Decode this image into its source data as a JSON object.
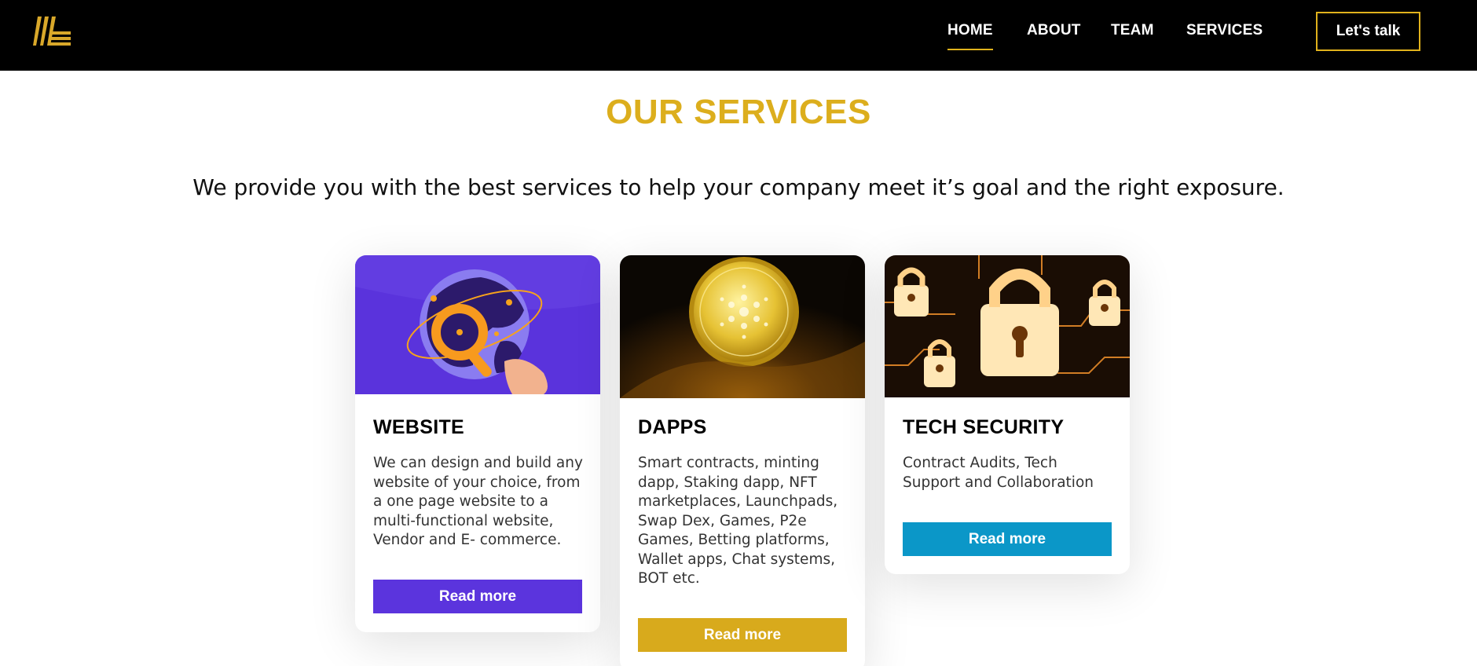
{
  "nav": {
    "items": [
      {
        "label": "HOME",
        "active": true
      },
      {
        "label": "ABOUT",
        "active": false
      },
      {
        "label": "TEAM",
        "active": false
      },
      {
        "label": "SERVICES",
        "active": false
      }
    ],
    "cta_label": "Let's talk"
  },
  "section": {
    "title": "OUR SERVICES",
    "subtitle": "We provide you with the best services to help your company meet it’s goal and the right exposure."
  },
  "cards": [
    {
      "title": "WEBSITE",
      "text": "We can design and build any website of your choice, from a one page website to a multi-functional website, Vendor and E- commerce.",
      "button": "Read more",
      "button_color": "#5b34dd",
      "image": "globe-magnifier-illustration"
    },
    {
      "title": "DAPPS",
      "text": "Smart contracts, minting dapp, Staking dapp, NFT marketplaces, Launchpads, Swap Dex, Games, P2e Games, Betting platforms, Wallet apps, Chat systems, BOT etc.",
      "button": "Read more",
      "button_color": "#d8aa1c",
      "image": "gold-coin-photo"
    },
    {
      "title": "TECH SECURITY",
      "text": "Contract Audits, Tech Support and Collaboration",
      "button": "Read more",
      "button_color": "#0b97c8",
      "image": "glowing-padlocks-photo"
    }
  ],
  "colors": {
    "accent": "#dcae1d",
    "topbar": "#000000"
  }
}
